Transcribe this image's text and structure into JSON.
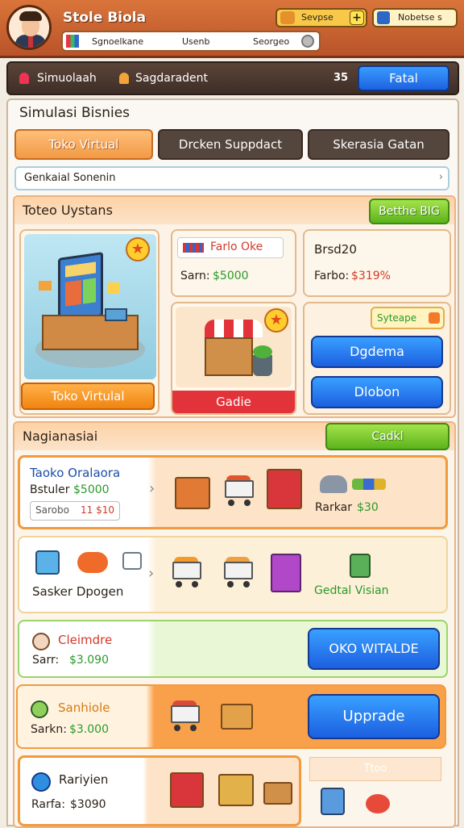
{
  "header": {
    "store_name": "Stole Biola",
    "resource_label": "Sevpse",
    "resource_plus": "+",
    "gem_label": "Nobetse s",
    "nav": [
      "Sgnoelkane",
      "Usenb",
      "Seorgeo"
    ]
  },
  "subbar": {
    "item1": "Simuolaah",
    "item2": "Sagdaradent",
    "count": "35",
    "button": "Fatal"
  },
  "panel": {
    "title": "Simulasi Bisnies",
    "tabs": [
      "Toko Virtual",
      "Drcken Suppdact",
      "Skerasia Gatan"
    ],
    "breadcrumb": "Genkaial Sonenin",
    "breadcrumb_chevron": "›"
  },
  "section1": {
    "title": "Toteo Uystans",
    "badge_button": "Betthe BIG",
    "card1_button": "Toko Virtulal",
    "card2_title": "Farlo Oke",
    "card2_label": "Sarn:",
    "card2_value": "$5000",
    "card3_title": "Brsd20",
    "card3_label": "Farbo:",
    "card3_value": "$319%",
    "card4_button": "Gadie",
    "card5_chip": "Syteape",
    "card5_btn1": "Dgdema",
    "card5_btn2": "Dlobon",
    "star": "★"
  },
  "section2": {
    "title": "Nagianasiai",
    "button": "Cadkl",
    "row1": {
      "title": "Taoko Oralaora",
      "label": "Bstuler",
      "value": "$5000",
      "field_label": "Sarobo",
      "field_value": "11 $10",
      "chevron": "›",
      "side_label": "Rarkar",
      "side_value": "$30"
    },
    "row2": {
      "title": "Sasker Dpogen",
      "chevron": "›",
      "side_label": "Gedtal Visian"
    },
    "row3": {
      "title": "Cleimdre",
      "label": "Sarr:",
      "value": "$3.090",
      "button": "OKO WITALDE"
    },
    "row4": {
      "title": "Sanhiole",
      "label": "Sarkn:",
      "value": "$3.000",
      "button": "Upprade"
    },
    "row5": {
      "title": "Rariyien",
      "label": "Rarfa:",
      "value": "$3090",
      "side_label": "Ttoo"
    }
  },
  "colors": {
    "header": "#c8612e",
    "accent_orange": "#f29a3c",
    "accent_blue": "#2271ee",
    "accent_green": "#7cc92b"
  }
}
